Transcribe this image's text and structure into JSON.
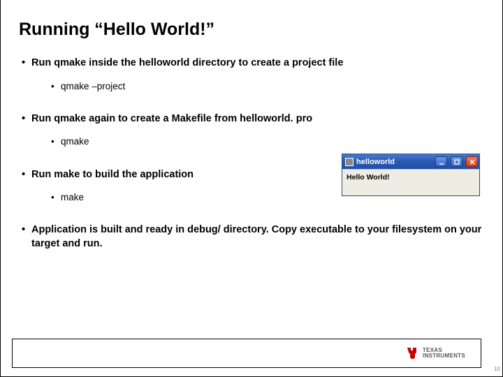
{
  "title": "Running “Hello World!”",
  "bullets": {
    "b1": "Run qmake inside the helloworld directory to create a project file",
    "b1a": "qmake –project",
    "b2": "Run qmake again to create a Makefile from helloworld. pro",
    "b2a": "qmake",
    "b3": "Run make to build the application",
    "b3a": "make",
    "b4": "Application is built and ready in debug/ directory. Copy executable to your filesystem on your target and run."
  },
  "window": {
    "title": "helloworld",
    "body": "Hello World!"
  },
  "logo": {
    "line1": "TEXAS",
    "line2": "INSTRUMENTS"
  },
  "pagenum": "10"
}
